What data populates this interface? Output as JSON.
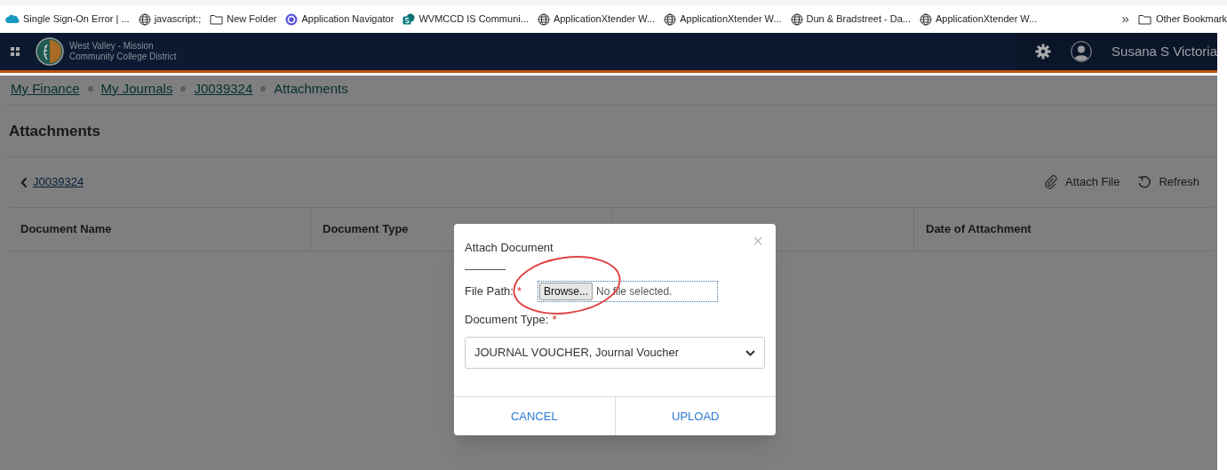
{
  "bookmarks": [
    {
      "label": "Single Sign-On Error | ...",
      "kind": "cloud"
    },
    {
      "label": "javascript:;",
      "kind": "globe"
    },
    {
      "label": "New Folder",
      "kind": "folder"
    },
    {
      "label": "Application Navigator",
      "kind": "navigator"
    },
    {
      "label": "WVMCCD IS Communi...",
      "kind": "sharepoint"
    },
    {
      "label": "ApplicationXtender W...",
      "kind": "globe"
    },
    {
      "label": "ApplicationXtender W...",
      "kind": "globe"
    },
    {
      "label": "Dun & Bradstreet - Da...",
      "kind": "globe"
    },
    {
      "label": "ApplicationXtender W...",
      "kind": "globe"
    }
  ],
  "bookmarks_overflow": "»",
  "other_bookmarks": "Other Bookmark",
  "header": {
    "org_line_1": "West Valley - Mission",
    "org_line_2": "Community College District",
    "user": "Susana S Victoria"
  },
  "breadcrumbs": [
    {
      "label": "My Finance",
      "link": true
    },
    {
      "label": "My Journals",
      "link": true
    },
    {
      "label": "J0039324",
      "link": true
    },
    {
      "label": "Attachments",
      "link": false
    }
  ],
  "page_title": "Attachments",
  "back_link": "J0039324",
  "actions": [
    {
      "label": "Attach File",
      "kind": "attach"
    },
    {
      "label": "Refresh",
      "kind": "refresh"
    }
  ],
  "table": {
    "columns": [
      "Document Name",
      "Document Type",
      null,
      "Date of Attachment"
    ]
  },
  "dialog": {
    "title": "Attach Document",
    "close": "×",
    "file_label": "File Path:",
    "file_required": true,
    "required_mark": "*",
    "browse_button": "Browse...",
    "file_status": "No file selected.",
    "type_label": "Document Type:",
    "type_required": true,
    "type_value": "JOURNAL VOUCHER, Journal Voucher",
    "buttons": [
      "CANCEL",
      "UPLOAD"
    ],
    "highlight": {
      "kind": "ellipse",
      "color": "#e04545"
    }
  }
}
